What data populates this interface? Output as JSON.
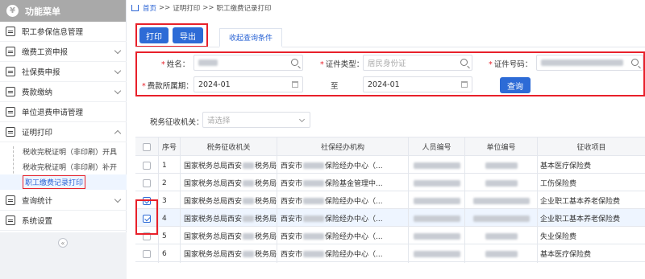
{
  "sidebar": {
    "title": "功能菜单",
    "items": [
      {
        "label": "职工参保信息管理",
        "chevron": false
      },
      {
        "label": "缴费工资申报",
        "chevron": true
      },
      {
        "label": "社保费申报",
        "chevron": true
      },
      {
        "label": "费款缴纳",
        "chevron": true
      },
      {
        "label": "单位退费申请管理",
        "chevron": false
      },
      {
        "label": "证明打印",
        "chevron": true,
        "expanded": true
      },
      {
        "label": "查询统计",
        "chevron": true
      },
      {
        "label": "系统设置",
        "chevron": false
      }
    ],
    "subitems": [
      {
        "label": "税收完税证明（非印刷）开具"
      },
      {
        "label": "税收完税证明（非印刷）补开"
      },
      {
        "label": "职工缴费记录打印",
        "active": true
      }
    ],
    "collapse": "«"
  },
  "breadcrumb": {
    "home": "首页",
    "sep": ">>",
    "level1": "证明打印",
    "level2": "职工缴费记录打印"
  },
  "toolbar": {
    "print": "打印",
    "export": "导出"
  },
  "tab": {
    "label": "收起查询条件"
  },
  "form": {
    "name_label": "姓名：",
    "idtype_label": "证件类型：",
    "idtype_placeholder": "居民身份证",
    "idno_label": "证件号码：",
    "period_label": "费款所属期：",
    "period_from": "2024-01",
    "period_to_label": "至",
    "period_to": "2024-01",
    "query": "查询",
    "tax_label": "税务征收机关：",
    "tax_placeholder": "请选择"
  },
  "table": {
    "headers": [
      "序号",
      "税务征收机关",
      "社保经办机构",
      "人员编号",
      "单位编号",
      "征收项目"
    ],
    "rows": [
      {
        "no": "1",
        "tax": "国家税务总局西安",
        "tax_suffix": "税务局",
        "agency": "西安市",
        "agency_suffix": "保险经办中心（...",
        "item": "基本医疗保险费",
        "checked": false
      },
      {
        "no": "2",
        "tax": "国家税务总局西安",
        "tax_suffix": "税务局",
        "agency": "西安市",
        "agency_suffix": "保险基金管理中...",
        "item": "工伤保险费",
        "checked": false
      },
      {
        "no": "3",
        "tax": "国家税务总局西安",
        "tax_suffix": "税务局",
        "agency": "西安市",
        "agency_suffix": "保险经办中心（...",
        "item": "企业职工基本养老保险费",
        "checked": true
      },
      {
        "no": "4",
        "tax": "国家税务总局西安",
        "tax_suffix": "税务局",
        "agency": "西安市",
        "agency_suffix": "保险经办中心（...",
        "item": "企业职工基本养老保险费",
        "checked": true
      },
      {
        "no": "5",
        "tax": "国家税务总局西安",
        "tax_suffix": "税务局",
        "agency": "西安市",
        "agency_suffix": "保险经办中心（...",
        "item": "失业保险费",
        "checked": false
      },
      {
        "no": "6",
        "tax": "国家税务总局西安",
        "tax_suffix": "税务局",
        "agency": "西安市",
        "agency_suffix": "保险经办中心（...",
        "item": "基本医疗保险费",
        "checked": false
      }
    ]
  }
}
